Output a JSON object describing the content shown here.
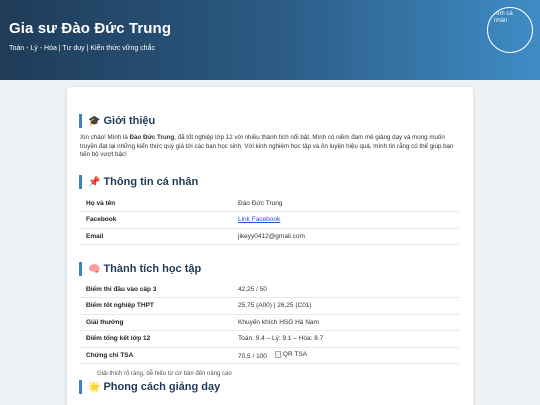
{
  "header": {
    "brand": "Gia sư Đào Đức Trung",
    "tagline": "Toán - Lý - Hóa | Tư duy | Kiến thức vững chắc",
    "avatar_alt": "Ảnh cá nhân"
  },
  "intro": {
    "icon": "🎓",
    "title": "Giới thiệu",
    "text_before": "Xin chào! Mình là ",
    "name": "Đào Đức Trung",
    "text_after": ", đã tốt nghiệp lớp 12 với nhiều thành tích nổi bật. Mình có niềm đam mê giảng dạy và mong muốn truyền đạt lại những kiến thức quý giá tới các bạn học sinh. Với kinh nghiệm học tập và ôn luyện hiệu quả, mình tin rằng có thể giúp bạn tiến bộ vượt bậc!"
  },
  "personal": {
    "icon": "📌",
    "title": "Thông tin cá nhân",
    "rows": [
      {
        "key": "Họ và tên",
        "value": "Đào Đức Trung"
      },
      {
        "key": "Facebook",
        "value": "Link Facebook"
      },
      {
        "key": "Email",
        "value": "jikeyy0412@gmail.com"
      }
    ]
  },
  "achievements": {
    "icon": "🧠",
    "title": "Thành tích học tập",
    "rows": [
      {
        "key": "Điểm thi đầu vào cấp 3",
        "value": "42,25 / 50"
      },
      {
        "key": "Điểm tốt nghiệp THPT",
        "value": "25,75 (A00) | 26,25 (C01)"
      },
      {
        "key": "Giải thưởng",
        "value": "Khuyến khích HSG Hà Nam"
      },
      {
        "key": "Điểm tổng kết lớp 12",
        "value": "Toán: 9.4 – Lý: 9.1 – Hóa: 8.7"
      },
      {
        "key": "Chứng chỉ TSA",
        "value": "70,5 / 100",
        "image_alt": "QR TSA"
      }
    ]
  },
  "style": {
    "icon": "🌟",
    "title": "Phong cách giảng dạy",
    "first_item": "Giải thích rõ ràng, dễ hiểu từ cơ bản đến nâng cao"
  }
}
